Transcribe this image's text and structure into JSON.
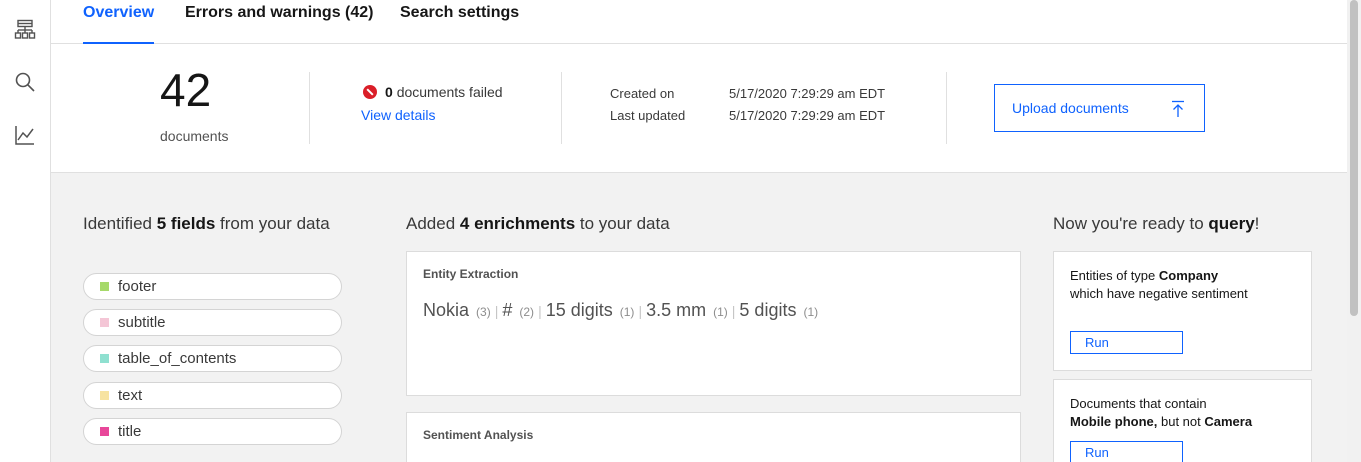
{
  "rail": {
    "icons": [
      "collection-tree-icon",
      "search-icon",
      "analytics-icon"
    ]
  },
  "tabs": [
    {
      "label": "Overview",
      "active": true
    },
    {
      "label": "Errors and warnings (42)",
      "active": false
    },
    {
      "label": "Search settings",
      "active": false
    }
  ],
  "summary": {
    "doc_count": "42",
    "doc_label": "documents",
    "failed_count": "0",
    "failed_label": "documents failed",
    "view_details": "View details",
    "created_label": "Created on",
    "created_value": "5/17/2020 7:29:29 am EDT",
    "updated_label": "Last updated",
    "updated_value": "5/17/2020 7:29:29 am EDT",
    "upload_label": "Upload documents"
  },
  "fields": {
    "title_pre": "Identified ",
    "title_bold": "5 fields",
    "title_post": " from your data",
    "items": [
      {
        "label": "footer",
        "color": "#a6d96a"
      },
      {
        "label": "subtitle",
        "color": "#f4c6d6"
      },
      {
        "label": "table_of_contents",
        "color": "#8fe0d0"
      },
      {
        "label": "text",
        "color": "#f7e3a1"
      },
      {
        "label": "title",
        "color": "#e8479a"
      }
    ]
  },
  "enrichments": {
    "title_pre": "Added ",
    "title_bold": "4 enrichments",
    "title_post": " to your data",
    "entity_card_title": "Entity Extraction",
    "entities": [
      {
        "name": "Nokia",
        "count": "(3)"
      },
      {
        "name": "#",
        "count": "(2)"
      },
      {
        "name": "15 digits",
        "count": "(1)"
      },
      {
        "name": "3.5 mm",
        "count": "(1)"
      },
      {
        "name": "5 digits",
        "count": "(1)"
      }
    ],
    "sentiment_card_title": "Sentiment Analysis"
  },
  "query": {
    "title_pre": "Now you're ready to ",
    "title_bold": "query",
    "title_post": "!",
    "card1": {
      "line1_pre": "Entities of type ",
      "line1_bold": "Company",
      "line2": "which have negative sentiment",
      "run": "Run"
    },
    "card2": {
      "line1": "Documents that contain",
      "line2_bold": "Mobile phone,",
      "line2_mid": " but not ",
      "line2_bold2": "Camera",
      "run": "Run"
    }
  },
  "colors": {
    "accent": "#0f62fe",
    "error": "#da1e28"
  }
}
